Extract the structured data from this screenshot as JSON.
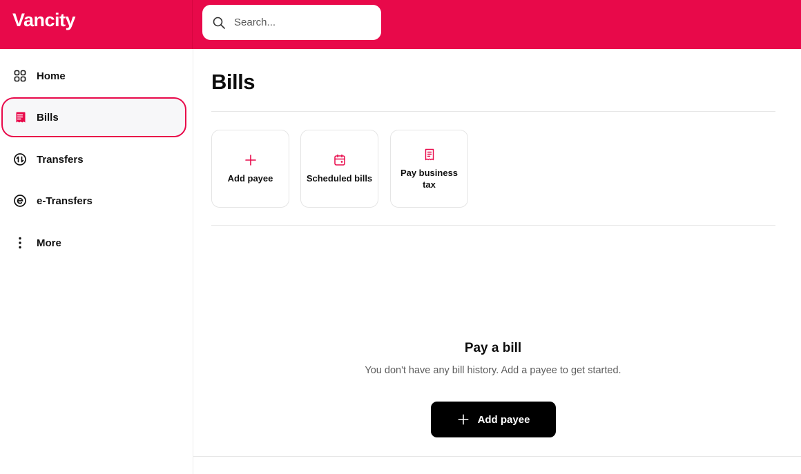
{
  "header": {
    "logo_text": "Vancity",
    "search_placeholder": "Search...",
    "brand_color": "#e8094a"
  },
  "sidebar": {
    "items": [
      {
        "label": "Home",
        "icon": "grid-icon",
        "active": false
      },
      {
        "label": "Bills",
        "icon": "receipt-icon",
        "active": true
      },
      {
        "label": "Transfers",
        "icon": "transfer-arrows-icon",
        "active": false
      },
      {
        "label": "e-Transfers",
        "icon": "e-transfer-icon",
        "active": false
      },
      {
        "label": "More",
        "icon": "more-vertical-icon",
        "active": false
      }
    ]
  },
  "main": {
    "title": "Bills",
    "actions": [
      {
        "label": "Add payee",
        "icon": "plus-icon"
      },
      {
        "label": "Scheduled bills",
        "icon": "calendar-icon"
      },
      {
        "label": "Pay business tax",
        "icon": "receipt-icon"
      }
    ],
    "empty_state": {
      "title": "Pay a bill",
      "description": "You don't have any bill history. Add a payee to get started.",
      "button_label": "Add payee",
      "button_icon": "plus-icon"
    }
  }
}
